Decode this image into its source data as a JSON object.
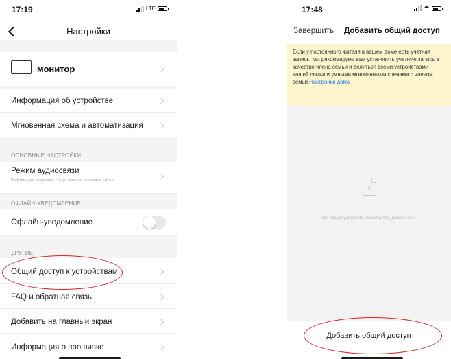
{
  "left_screen": {
    "status_time": "17:19",
    "network": "LTE",
    "nav": {
      "title": "Настройки"
    },
    "device": {
      "name": "монитор"
    },
    "rows_top": [
      {
        "label": "Информация об устройстве"
      },
      {
        "label": "Мгновенная схема и автоматизация"
      }
    ],
    "section_basic": {
      "header": "ОСНОВНЫЕ НАСТРОЙКИ",
      "audio_label": "Режим аудиосвязи",
      "audio_sub": "Информация, например, статус лампы и переворот экрана"
    },
    "section_offline": {
      "header": "ОФЛАЙН-УВЕДОМЛЕНИЕ",
      "toggle_label": "Офлайн-уведомление",
      "toggle_on": false
    },
    "section_other": {
      "header": "ДРУГИЕ",
      "items": [
        {
          "label": "Общий доступ к устройствам"
        },
        {
          "label": "FAQ и обратная связь"
        },
        {
          "label": "Добавить на главный экран"
        },
        {
          "label": "Информация о прошивке"
        }
      ]
    }
  },
  "right_screen": {
    "status_time": "17:48",
    "nav": {
      "done": "Завершить",
      "title": "Добавить общий доступ"
    },
    "notice": {
      "text": "Если у постоянного жителя в вашем доме есть учетная запись, мы рекомендуем вам установить учетную запись в качестве члена семьи и делиться всеми устройствами вашей семьи и умными мгновенными сценами с членом семьи.",
      "link": "Настройки дома"
    },
    "empty_text": "Нет общих устройств, пожалуйста, добавьте их.",
    "add_button": "Добавить общий доступ"
  },
  "colors": {
    "highlight_ellipse": "#d9251c",
    "notice_background": "#fdf5cd",
    "link": "#2d7de6"
  },
  "icons": [
    "back-chevron-icon",
    "monitor-icon",
    "chevron-right-icon",
    "add-file-icon",
    "signal-icon",
    "wifi-icon",
    "battery-icon"
  ]
}
